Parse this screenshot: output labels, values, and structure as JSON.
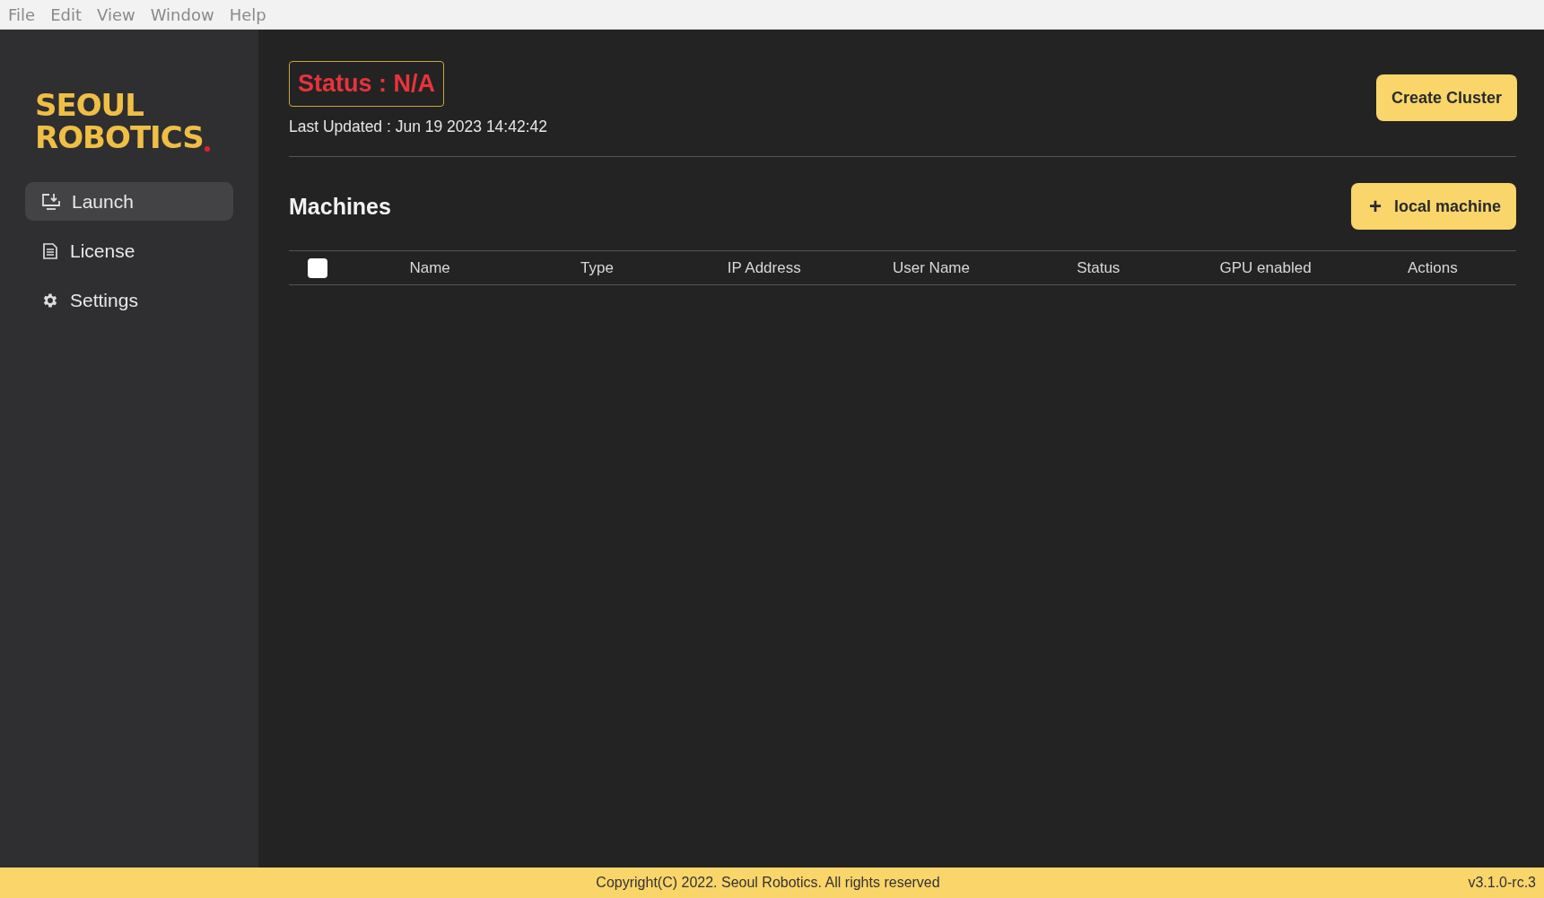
{
  "menu_bar": [
    "File",
    "Edit",
    "View",
    "Window",
    "Help"
  ],
  "logo": {
    "lines": [
      "SEOUL",
      "ROBOTICS"
    ]
  },
  "sidebar": {
    "items": [
      {
        "label": "Launch",
        "selected": true
      },
      {
        "label": "License",
        "selected": false
      },
      {
        "label": "Settings",
        "selected": false
      }
    ]
  },
  "header": {
    "status": "Status : N/A",
    "last_updated": "Last Updated : Jun 19 2023 14:42:42",
    "create_button": "Create Cluster"
  },
  "machines": {
    "title": "Machines",
    "add_button": {
      "icon": "+",
      "label": "local machine"
    },
    "table": {
      "select_all": {
        "checked": false
      },
      "columns": [
        "Name",
        "Type",
        "IP Address",
        "User Name",
        "Status",
        "GPU enabled",
        "Actions"
      ]
    }
  },
  "footer": {
    "copyright": "Copyright(C) 2022. Seoul Robotics. All rights reserved",
    "version": "v3.1.0-rc.3"
  }
}
